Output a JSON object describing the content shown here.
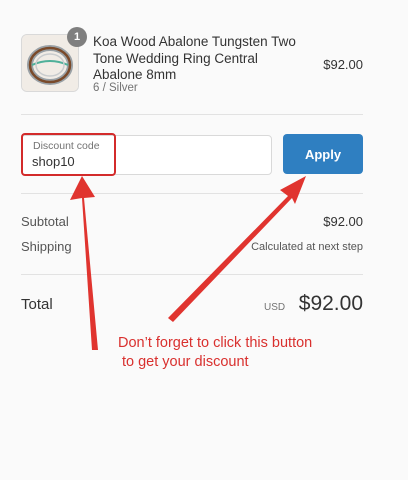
{
  "order": {
    "product": {
      "quantity": "1",
      "title": "Koa Wood Abalone Tungsten Two Tone Wedding Ring Central Abalone 8mm",
      "variant": "6 / Silver",
      "price": "$92.00",
      "thumbnail_icon": "ring-image"
    },
    "discount": {
      "label": "Discount code",
      "value": "shop10",
      "apply_label": "Apply"
    },
    "summary": {
      "subtotal_label": "Subtotal",
      "subtotal_value": "$92.00",
      "shipping_label": "Shipping",
      "shipping_value": "Calculated at next step",
      "total_label": "Total",
      "currency": "USD",
      "total_value": "$92.00"
    }
  },
  "annotation": {
    "line1": "Don’t forget to click this button",
    "line2": "to get your discount",
    "color": "#d9302e"
  },
  "colors": {
    "apply_button": "#2f7fc1",
    "highlight": "#d32b2b"
  }
}
